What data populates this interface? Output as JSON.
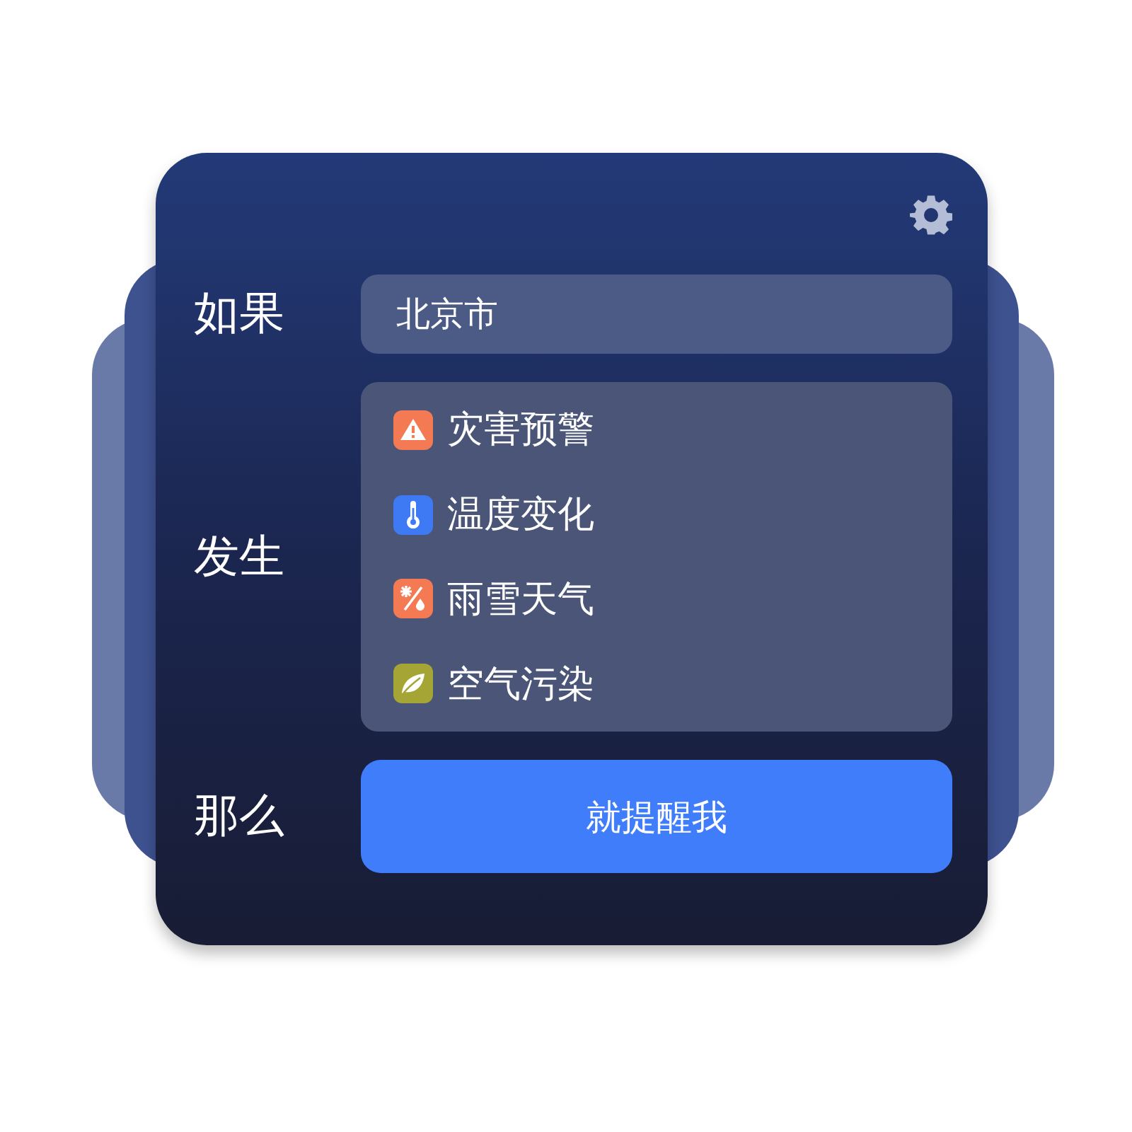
{
  "rows": [
    {
      "label": "如果",
      "kind": "field",
      "value": "北京市"
    },
    {
      "label": "发生",
      "kind": "list",
      "items": [
        {
          "text": "灾害预警",
          "kind": "warning",
          "color": "#f47a54"
        },
        {
          "text": "温度变化",
          "kind": "thermometer",
          "color": "#3f7af5"
        },
        {
          "text": "雨雪天气",
          "kind": "weather",
          "color": "#f47a54"
        },
        {
          "text": "空气污染",
          "kind": "leaf",
          "color": "#a5a535"
        }
      ]
    },
    {
      "label": "那么",
      "kind": "button",
      "value": "就提醒我"
    }
  ]
}
